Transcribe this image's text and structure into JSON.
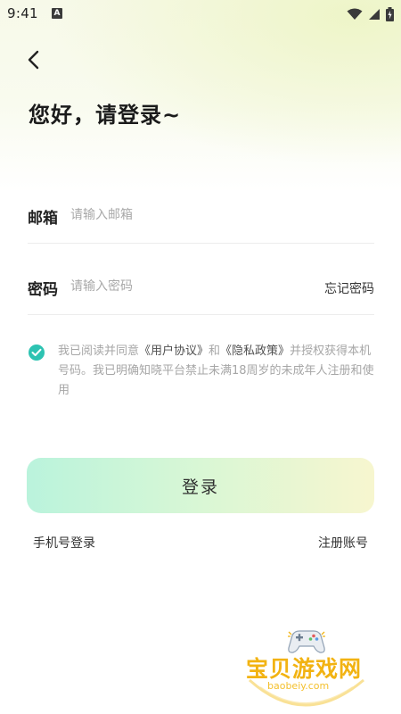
{
  "status_bar": {
    "time": "9:41",
    "notification_badge": "A"
  },
  "header": {
    "greeting": "您好，请登录~"
  },
  "form": {
    "email_label": "邮箱",
    "email_placeholder": "请输入邮箱",
    "password_label": "密码",
    "password_placeholder": "请输入密码",
    "forgot_password": "忘记密码"
  },
  "agreement": {
    "checked": true,
    "text_prefix": "我已阅读并同意",
    "user_agreement": "《用户协议》",
    "and": "和",
    "privacy_policy": "《隐私政策》",
    "text_suffix": "并授权获得本机号码。我已明确知晓平台禁止未满18周岁的未成年人注册和使用"
  },
  "actions": {
    "login_label": "登录",
    "phone_login": "手机号登录",
    "register": "注册账号"
  },
  "watermark": {
    "title": "宝贝游戏网",
    "url": "baobeiy.com"
  },
  "colors": {
    "accent": "#2dc3b2",
    "button_gradient_start": "#baf3dc",
    "button_gradient_end": "#f7f6cf",
    "watermark": "#f2b312"
  }
}
